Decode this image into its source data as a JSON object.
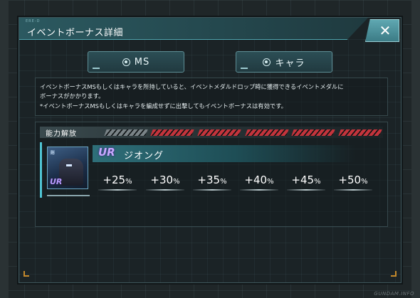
{
  "dialog": {
    "code": "ERE-D",
    "title": "イベントボーナス詳細",
    "close_label": "✕"
  },
  "tabs": [
    {
      "label": "MS",
      "icon": "target-icon"
    },
    {
      "label": "キャラ",
      "icon": "target-icon"
    }
  ],
  "description": {
    "line1": "イベントボーナスMSもしくはキャラを所持していると、イベントメダルドロップ時に獲得できるイベントメダルに",
    "line2": "ボーナスがかかります。",
    "line3": "*イベントボーナスMSもしくはキャラを編成せずに出撃してもイベントボーナスは有効です。"
  },
  "ability": {
    "label": "能力解放",
    "levels": [
      {
        "state": "locked"
      },
      {
        "state": "unlocked"
      },
      {
        "state": "unlocked"
      },
      {
        "state": "unlocked"
      },
      {
        "state": "unlocked"
      },
      {
        "state": "unlocked"
      }
    ]
  },
  "unit": {
    "rank": "UR",
    "name": "ジオング",
    "thumb_rank": "UR",
    "bonuses": [
      {
        "value": "+25",
        "unit": "%"
      },
      {
        "value": "+30",
        "unit": "%"
      },
      {
        "value": "+35",
        "unit": "%"
      },
      {
        "value": "+40",
        "unit": "%"
      },
      {
        "value": "+45",
        "unit": "%"
      },
      {
        "value": "+50",
        "unit": "%"
      }
    ]
  },
  "colors": {
    "accent": "#4fc4d3",
    "slot_on": "#c3343c",
    "slot_off": "#7a8387",
    "rank": "#c8a8ff"
  },
  "watermark": "GUNDAM.INFO"
}
